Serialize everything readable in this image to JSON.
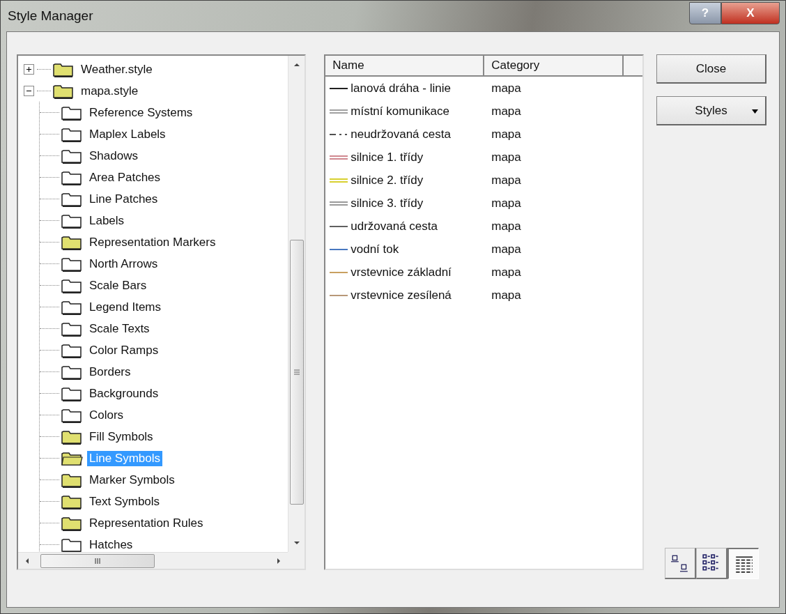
{
  "window": {
    "title": "Style Manager",
    "controls": [
      {
        "kind": "help",
        "label": "?"
      },
      {
        "kind": "close",
        "label": "X"
      }
    ]
  },
  "tree": [
    {
      "label": "Weather.style",
      "filled": true,
      "expanded": false,
      "selected": false
    },
    {
      "label": "mapa.style",
      "filled": true,
      "expanded": true,
      "selected": false,
      "children": [
        {
          "label": "Reference Systems",
          "filled": false,
          "selected": false
        },
        {
          "label": "Maplex Labels",
          "filled": false,
          "selected": false
        },
        {
          "label": "Shadows",
          "filled": false,
          "selected": false
        },
        {
          "label": "Area Patches",
          "filled": false,
          "selected": false
        },
        {
          "label": "Line Patches",
          "filled": false,
          "selected": false
        },
        {
          "label": "Labels",
          "filled": false,
          "selected": false
        },
        {
          "label": "Representation Markers",
          "filled": true,
          "selected": false
        },
        {
          "label": "North Arrows",
          "filled": false,
          "selected": false
        },
        {
          "label": "Scale Bars",
          "filled": false,
          "selected": false
        },
        {
          "label": "Legend Items",
          "filled": false,
          "selected": false
        },
        {
          "label": "Scale Texts",
          "filled": false,
          "selected": false
        },
        {
          "label": "Color Ramps",
          "filled": false,
          "selected": false
        },
        {
          "label": "Borders",
          "filled": false,
          "selected": false
        },
        {
          "label": "Backgrounds",
          "filled": false,
          "selected": false
        },
        {
          "label": "Colors",
          "filled": false,
          "selected": false
        },
        {
          "label": "Fill Symbols",
          "filled": true,
          "selected": false
        },
        {
          "label": "Line Symbols",
          "filled": true,
          "selected": true
        },
        {
          "label": "Marker Symbols",
          "filled": true,
          "selected": false
        },
        {
          "label": "Text Symbols",
          "filled": true,
          "selected": false
        },
        {
          "label": "Representation Rules",
          "filled": true,
          "selected": false
        },
        {
          "label": "Hatches",
          "filled": false,
          "selected": false
        }
      ]
    }
  ],
  "scrollbar_label": "III",
  "table": {
    "columns": [
      "Name",
      "Category"
    ],
    "rows": [
      {
        "name": "lanová dráha - linie",
        "category": "mapa",
        "kind": "single",
        "color": "#202020"
      },
      {
        "name": "místní komunikace",
        "category": "mapa",
        "kind": "double",
        "color": "#a0a0a0"
      },
      {
        "name": "neudržovaná cesta",
        "category": "mapa",
        "kind": "dashed",
        "color": "#505050"
      },
      {
        "name": "silnice 1. třídy",
        "category": "mapa",
        "kind": "double",
        "color": "#d08890"
      },
      {
        "name": "silnice 2. třídy",
        "category": "mapa",
        "kind": "double",
        "color": "#d8d030"
      },
      {
        "name": "silnice 3. třídy",
        "category": "mapa",
        "kind": "double",
        "color": "#9a9a9a"
      },
      {
        "name": "udržovaná cesta",
        "category": "mapa",
        "kind": "single",
        "color": "#606060"
      },
      {
        "name": "vodní tok",
        "category": "mapa",
        "kind": "single",
        "color": "#4878c0"
      },
      {
        "name": "vrstevnice základní",
        "category": "mapa",
        "kind": "single",
        "color": "#c8a060"
      },
      {
        "name": "vrstevnice zesílená",
        "category": "mapa",
        "kind": "single",
        "color": "#b89878"
      }
    ]
  },
  "buttons": [
    {
      "label": "Close",
      "kind": "plain"
    },
    {
      "label": "Styles",
      "kind": "dropdown"
    }
  ],
  "view_buttons": [
    {
      "kind": "icons",
      "selected": false
    },
    {
      "kind": "list",
      "selected": false
    },
    {
      "kind": "details",
      "selected": true
    }
  ]
}
